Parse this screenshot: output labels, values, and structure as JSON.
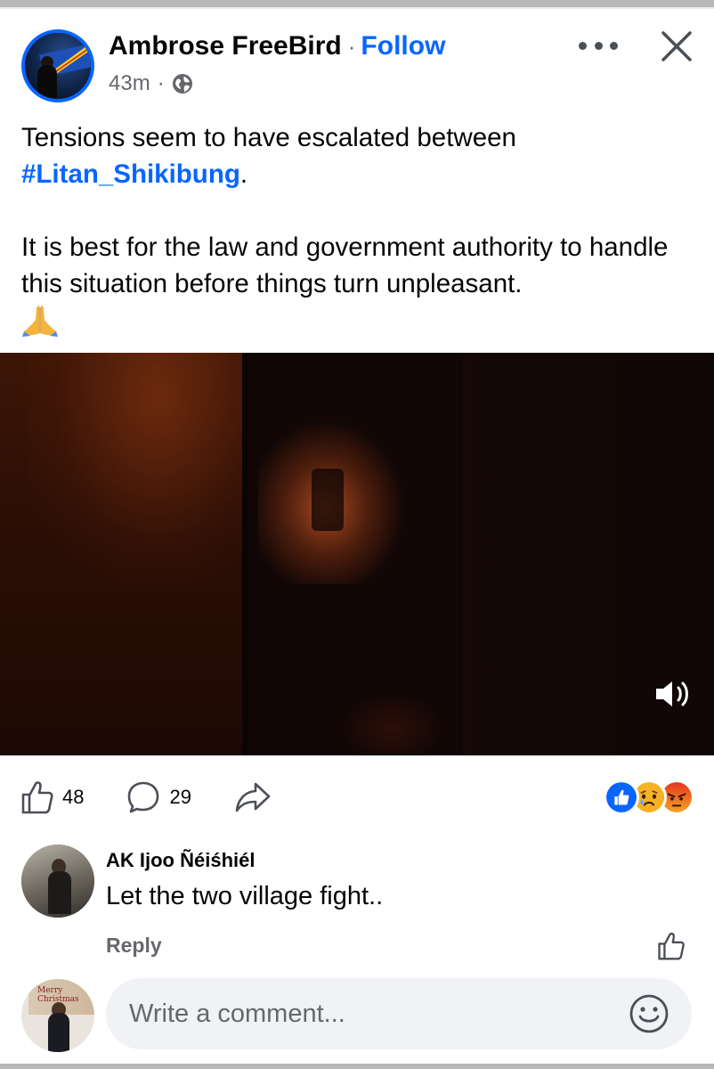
{
  "post": {
    "author": "Ambrose FreeBird",
    "separator": "·",
    "follow_label": "Follow",
    "time": "43m",
    "time_separator": "·",
    "audience_icon": "globe-icon",
    "more_icon": "more-options-icon",
    "close_icon": "close-icon",
    "text_line1": "Tensions seem to have escalated between",
    "hashtag": "#Litan_Shikibung",
    "hashtag_suffix": ".",
    "text_paragraph2": "It is best for the law and government authority to handle this situation before things turn unpleasant.",
    "emoji": "pray-icon"
  },
  "video": {
    "sound_icon": "volume-icon"
  },
  "actions": {
    "likes": "48",
    "comments": "29",
    "like_icon": "thumbs-up-icon",
    "comment_icon": "comment-bubble-icon",
    "share_icon": "share-arrow-icon",
    "reactions": [
      "like",
      "sad",
      "angry"
    ],
    "colors": {
      "like": "#0866ff",
      "sad": "#f7b125",
      "angry": "#e9710f"
    }
  },
  "comment": {
    "name": "AK Ijoo Ñéiśhiél",
    "text": "Let the two village fight..",
    "reply_label": "Reply"
  },
  "compose": {
    "placeholder": "Write a comment...",
    "emoji_icon": "smiley-icon",
    "avatar_banner": "Merry Christmas"
  },
  "colors": {
    "accent": "#0866ff",
    "text": "#050505",
    "secondary_text": "#65676b",
    "input_bg": "#f0f2f5"
  }
}
